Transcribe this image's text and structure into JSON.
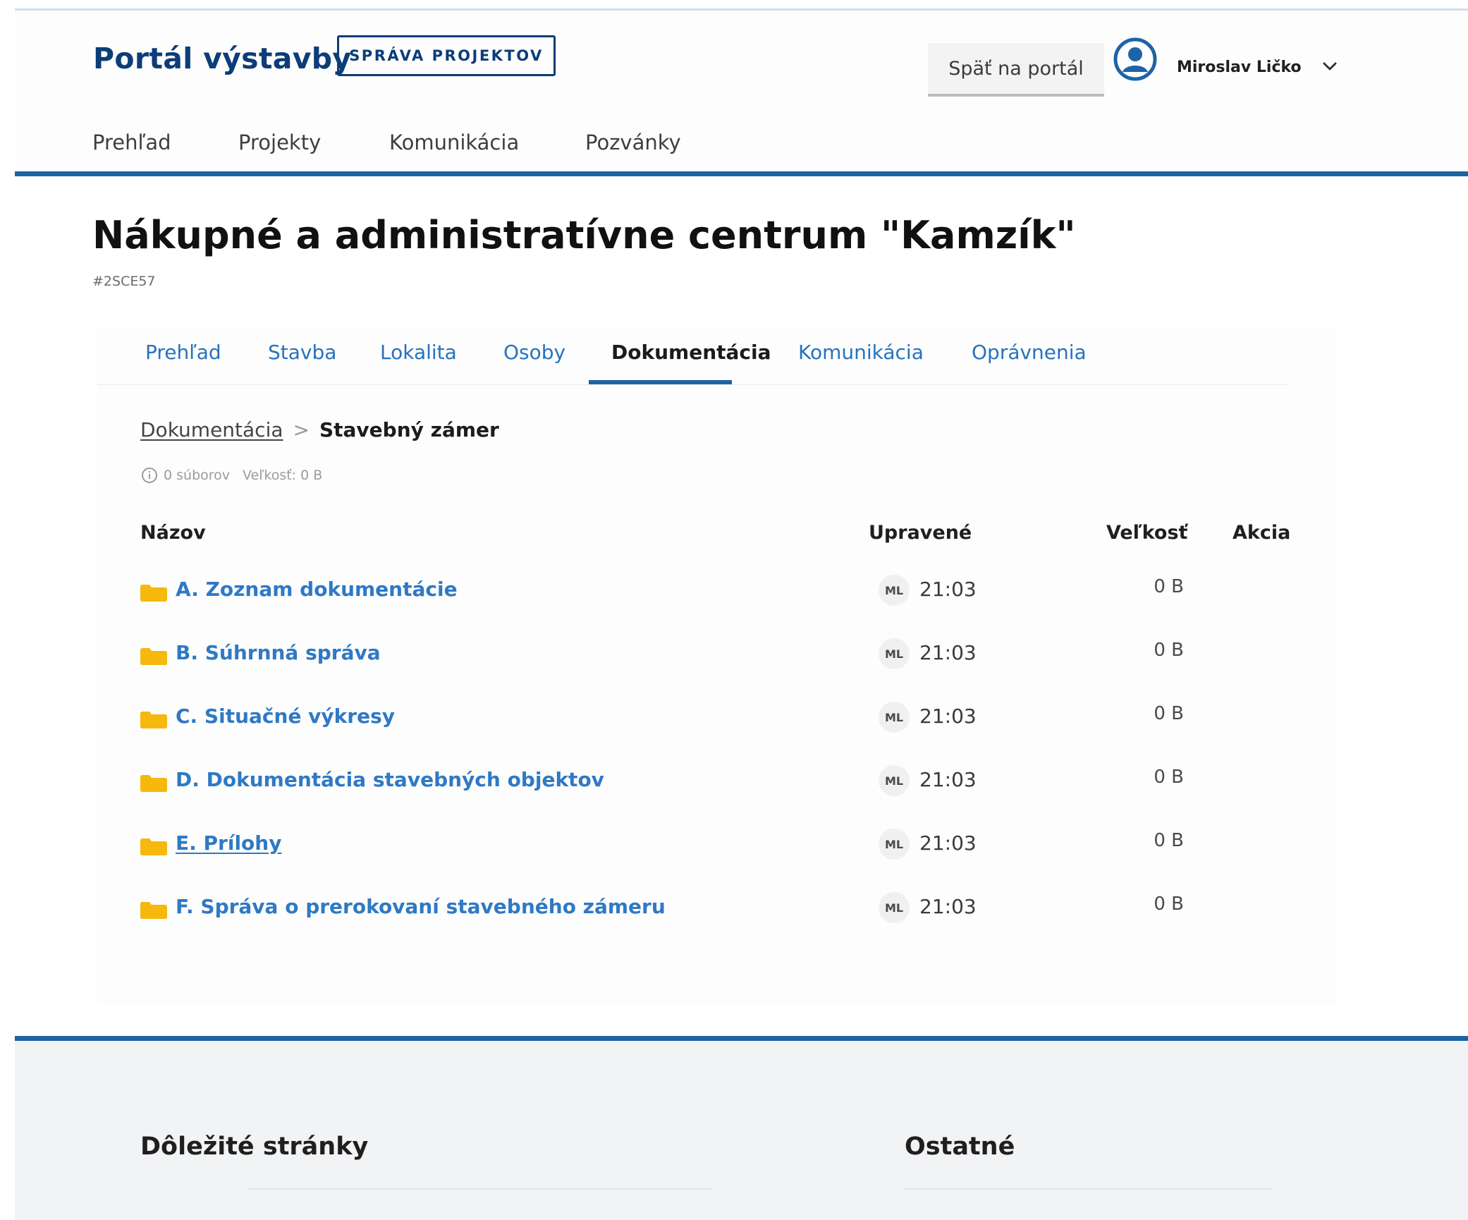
{
  "header": {
    "logo": "Portál výstavby",
    "badge": "SPRÁVA PROJEKTOV",
    "back_button": "Späť na portál",
    "user_name": "Miroslav Ličko"
  },
  "main_nav": [
    {
      "label": "Prehľad"
    },
    {
      "label": "Projekty"
    },
    {
      "label": "Komunikácia"
    },
    {
      "label": "Pozvánky"
    }
  ],
  "project": {
    "title": "Nákupné a administratívne centrum \"Kamzík\"",
    "id": "#2SCE57"
  },
  "tabs": [
    {
      "label": "Prehľad"
    },
    {
      "label": "Stavba"
    },
    {
      "label": "Lokalita"
    },
    {
      "label": "Osoby"
    },
    {
      "label": "Dokumentácia",
      "active": true
    },
    {
      "label": "Komunikácia"
    },
    {
      "label": "Oprávnenia"
    }
  ],
  "breadcrumb": {
    "parent": "Dokumentácia",
    "separator": ">",
    "current": "Stavebný zámer"
  },
  "stats": {
    "files": "0 súborov",
    "size": "Veľkosť: 0 B"
  },
  "table": {
    "columns": {
      "name": "Názov",
      "modified": "Upravené",
      "size": "Veľkosť",
      "action": "Akcia"
    },
    "rows": [
      {
        "name": "A. Zoznam dokumentácie",
        "initials": "ML",
        "time": "21:03",
        "size": "0 B"
      },
      {
        "name": "B. Súhrnná správa",
        "initials": "ML",
        "time": "21:03",
        "size": "0 B"
      },
      {
        "name": "C. Situačné výkresy",
        "initials": "ML",
        "time": "21:03",
        "size": "0 B"
      },
      {
        "name": "D. Dokumentácia stavebných objektov",
        "initials": "ML",
        "time": "21:03",
        "size": "0 B"
      },
      {
        "name": "E. Prílohy",
        "initials": "ML",
        "time": "21:03",
        "size": "0 B"
      },
      {
        "name": "F. Správa o prerokovaní stavebného zámeru",
        "initials": "ML",
        "time": "21:03",
        "size": "0 B"
      }
    ]
  },
  "footer": {
    "important": "Dôležité stránky",
    "other": "Ostatné"
  },
  "colors": {
    "brand": "#0b3d78",
    "accent": "#1e63a6",
    "link": "#2f79c5",
    "folder": "#f6b80c"
  },
  "icons": {
    "avatar": "user-circle-icon",
    "chevron": "chevron-down-icon",
    "info": "info-icon",
    "folder": "folder-icon"
  }
}
